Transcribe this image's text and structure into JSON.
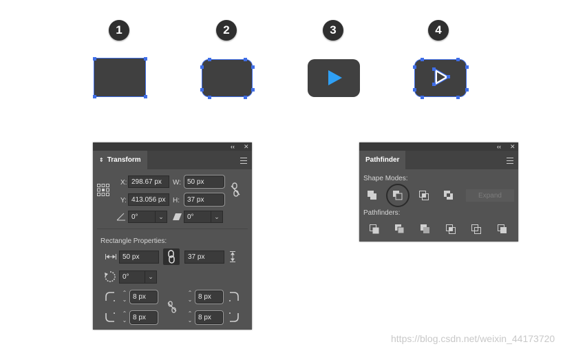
{
  "steps": [
    "1",
    "2",
    "3",
    "4"
  ],
  "colors": {
    "shape": "#404040",
    "selection": "#3f6ee8",
    "play": "#2fa0f5",
    "panel": "#535353"
  },
  "transform_panel": {
    "tab": "Transform",
    "x_label": "X:",
    "x_value": "298.67 px",
    "y_label": "Y:",
    "y_value": "413.056 px",
    "w_label": "W:",
    "w_value": "50 px",
    "h_label": "H:",
    "h_value": "37 px",
    "angle_value": "0°",
    "shear_value": "0°",
    "rect_props_label": "Rectangle Properties:",
    "rect_width": "50 px",
    "rect_height": "37 px",
    "rect_angle": "0°",
    "corner_tl": "8 px",
    "corner_tr": "8 px",
    "corner_bl": "8 px",
    "corner_br": "8 px"
  },
  "pathfinder_panel": {
    "tab": "Pathfinder",
    "shape_modes_label": "Shape Modes:",
    "expand_label": "Expand",
    "pathfinders_label": "Pathfinders:"
  },
  "watermark": "https://blog.csdn.net/weixin_44173720"
}
